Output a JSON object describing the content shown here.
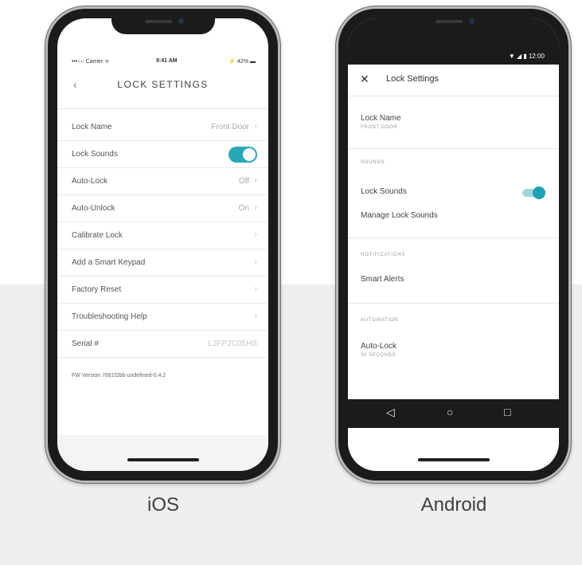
{
  "ios": {
    "status": {
      "carrier": "•••○○ Carrier ᯤ",
      "time": "9:41 AM",
      "battery": "⚡ 42% ▬"
    },
    "back": "‹",
    "title": "LOCK SETTINGS",
    "rows": [
      {
        "label": "Lock Name",
        "value": "Front Door",
        "chevron": "›"
      },
      {
        "label": "Lock Sounds",
        "toggle": true
      },
      {
        "label": "Auto-Lock",
        "value": "Off",
        "chevron": "›"
      },
      {
        "label": "Auto-Unlock",
        "value": "On",
        "chevron": "›"
      },
      {
        "label": "Calibrate Lock",
        "chevron": "›"
      },
      {
        "label": "Add a Smart Keypad",
        "chevron": "›"
      },
      {
        "label": "Factory Reset",
        "chevron": "›"
      },
      {
        "label": "Troubleshooting Help",
        "chevron": "›"
      },
      {
        "label": "Serial #",
        "value": "L2FP2C05HS"
      }
    ],
    "fw_version": "FW Version 7881f2bb-undefined-0.4.2",
    "caption": "iOS"
  },
  "android": {
    "status": {
      "icons": "▼ ◢ ▮ 12:00"
    },
    "close": "✕",
    "title": "Lock Settings",
    "lock_name": {
      "label": "Lock Name",
      "value": "FRONT DOOR"
    },
    "sounds": {
      "header": "SOUNDS",
      "lock_sounds": "Lock Sounds",
      "manage": "Manage Lock Sounds"
    },
    "notifications": {
      "header": "NOTIFICATIONS",
      "smart_alerts": "Smart Alerts"
    },
    "automation": {
      "header": "AUTOMATION",
      "auto_lock": "Auto-Lock",
      "auto_lock_value": "30 SECONDS"
    },
    "nav": {
      "back": "◁",
      "home": "○",
      "recents": "□"
    },
    "caption": "Android"
  },
  "colors": {
    "accent": "#27a9b5",
    "background_band": "#efefed"
  }
}
